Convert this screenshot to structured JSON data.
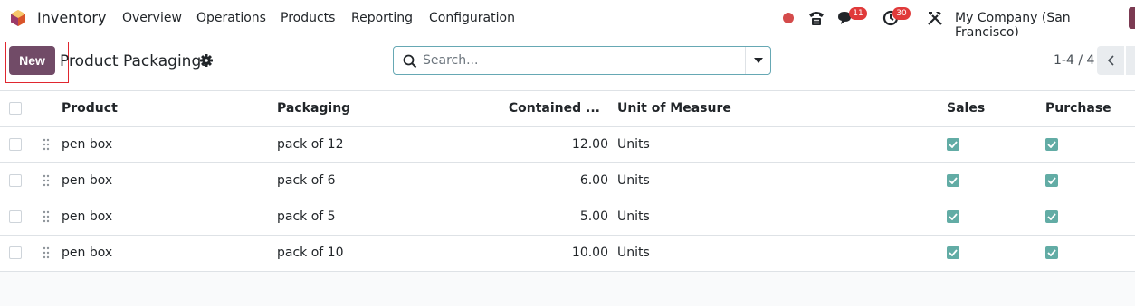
{
  "navbar": {
    "app_name": "Inventory",
    "menus": [
      "Overview",
      "Operations",
      "Products",
      "Reporting",
      "Configuration"
    ],
    "messages_count": "11",
    "activities_count": "30",
    "company": "My Company (San Francisco)"
  },
  "control_panel": {
    "new_label": "New",
    "breadcrumb": "Product Packagings",
    "search_placeholder": "Search...",
    "pager": "1-4 / 4"
  },
  "table": {
    "headers": {
      "product": "Product",
      "packaging": "Packaging",
      "contained": "Contained ...",
      "uom": "Unit of Measure",
      "sales": "Sales",
      "purchase": "Purchase"
    },
    "rows": [
      {
        "product": "pen box",
        "packaging": "pack of 12",
        "contained": "12.00",
        "uom": "Units",
        "sales": true,
        "purchase": true
      },
      {
        "product": "pen box",
        "packaging": "pack of 6",
        "contained": "6.00",
        "uom": "Units",
        "sales": true,
        "purchase": true
      },
      {
        "product": "pen box",
        "packaging": "pack of 5",
        "contained": "5.00",
        "uom": "Units",
        "sales": true,
        "purchase": true
      },
      {
        "product": "pen box",
        "packaging": "pack of 10",
        "contained": "10.00",
        "uom": "Units",
        "sales": true,
        "purchase": true
      }
    ]
  },
  "colors": {
    "primary": "#714b67",
    "checkbox_checked": "#62aca5",
    "badge": "#e03a3a",
    "highlight_box": "#e0272f"
  }
}
